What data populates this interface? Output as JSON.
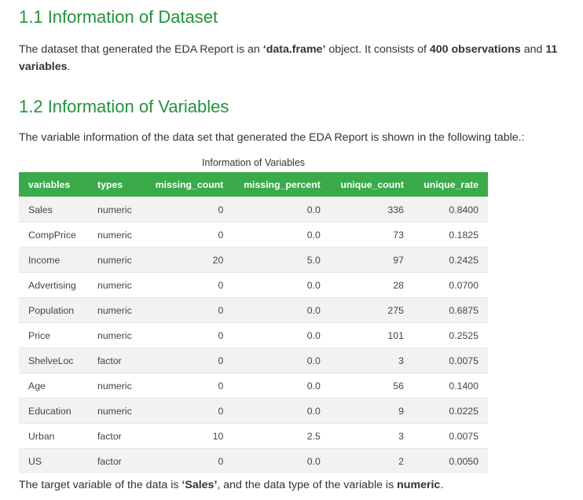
{
  "sections": {
    "dataset_heading": "1.1 Information of Dataset",
    "dataset_text": {
      "t1": "The dataset that generated the EDA Report is an ",
      "b1": "‘data.frame’",
      "t2": " object. It consists of ",
      "b2": "400 observations",
      "t3": " and ",
      "b3": "11 variables",
      "t4": "."
    },
    "variables_heading": "1.2 Information of Variables",
    "variables_text": "The variable information of the data set that generated the EDA Report is shown in the following table.:",
    "target_text": {
      "t1": "The target variable of the data is ",
      "b1": "‘Sales’",
      "t2": ", and the data type of the variable is ",
      "b2": "numeric",
      "t3": "."
    }
  },
  "table": {
    "caption": "Information of Variables",
    "headers": [
      "variables",
      "types",
      "missing_count",
      "missing_percent",
      "unique_count",
      "unique_rate"
    ],
    "rows": [
      [
        "Sales",
        "numeric",
        "0",
        "0.0",
        "336",
        "0.8400"
      ],
      [
        "CompPrice",
        "numeric",
        "0",
        "0.0",
        "73",
        "0.1825"
      ],
      [
        "Income",
        "numeric",
        "20",
        "5.0",
        "97",
        "0.2425"
      ],
      [
        "Advertising",
        "numeric",
        "0",
        "0.0",
        "28",
        "0.0700"
      ],
      [
        "Population",
        "numeric",
        "0",
        "0.0",
        "275",
        "0.6875"
      ],
      [
        "Price",
        "numeric",
        "0",
        "0.0",
        "101",
        "0.2525"
      ],
      [
        "ShelveLoc",
        "factor",
        "0",
        "0.0",
        "3",
        "0.0075"
      ],
      [
        "Age",
        "numeric",
        "0",
        "0.0",
        "56",
        "0.1400"
      ],
      [
        "Education",
        "numeric",
        "0",
        "0.0",
        "9",
        "0.0225"
      ],
      [
        "Urban",
        "factor",
        "10",
        "2.5",
        "3",
        "0.0075"
      ],
      [
        "US",
        "factor",
        "0",
        "0.0",
        "2",
        "0.0050"
      ]
    ]
  },
  "colors": {
    "heading": "#22933a",
    "table_header": "#3aaa4a",
    "row_stripe": "#f2f2f2"
  }
}
